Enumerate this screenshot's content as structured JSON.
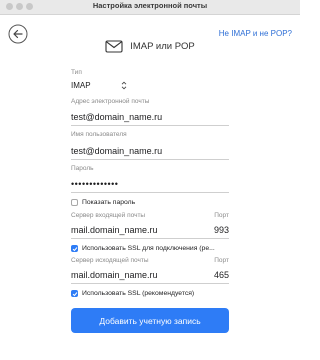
{
  "window": {
    "title": "Настройка электронной почты"
  },
  "nav": {
    "help_link": "Не IMAP и не POP?"
  },
  "header": {
    "title": "IMAP или POP"
  },
  "form": {
    "type_label": "Тип",
    "type_value": "IMAP",
    "email_label": "Адрес электронной почты",
    "email_value": "test@domain_name.ru",
    "username_label": "Имя пользователя",
    "username_value": "test@domain_name.ru",
    "password_label": "Пароль",
    "password_value": "•••••••••••••",
    "show_password_label": "Показать пароль",
    "incoming_label": "Сервер входящей почты",
    "incoming_value": "mail.domain_name.ru",
    "port_label": "Порт",
    "incoming_port": "993",
    "incoming_ssl_label": "Использовать SSL для подключения (ре...",
    "outgoing_label": "Сервер исходящей почты",
    "outgoing_value": "mail.domain_name.ru",
    "outgoing_port_label": "Порт",
    "outgoing_port": "465",
    "outgoing_ssl_label": "Использовать SSL (рекомендуется)",
    "submit_label": "Добавить учетную запись"
  },
  "icons": {
    "back": "back-arrow-icon",
    "envelope": "envelope-icon",
    "chevron": "chevron-updown-icon",
    "check": "checkmark-icon"
  },
  "colors": {
    "accent": "#2e7cf6",
    "link": "#2e6fd6"
  }
}
